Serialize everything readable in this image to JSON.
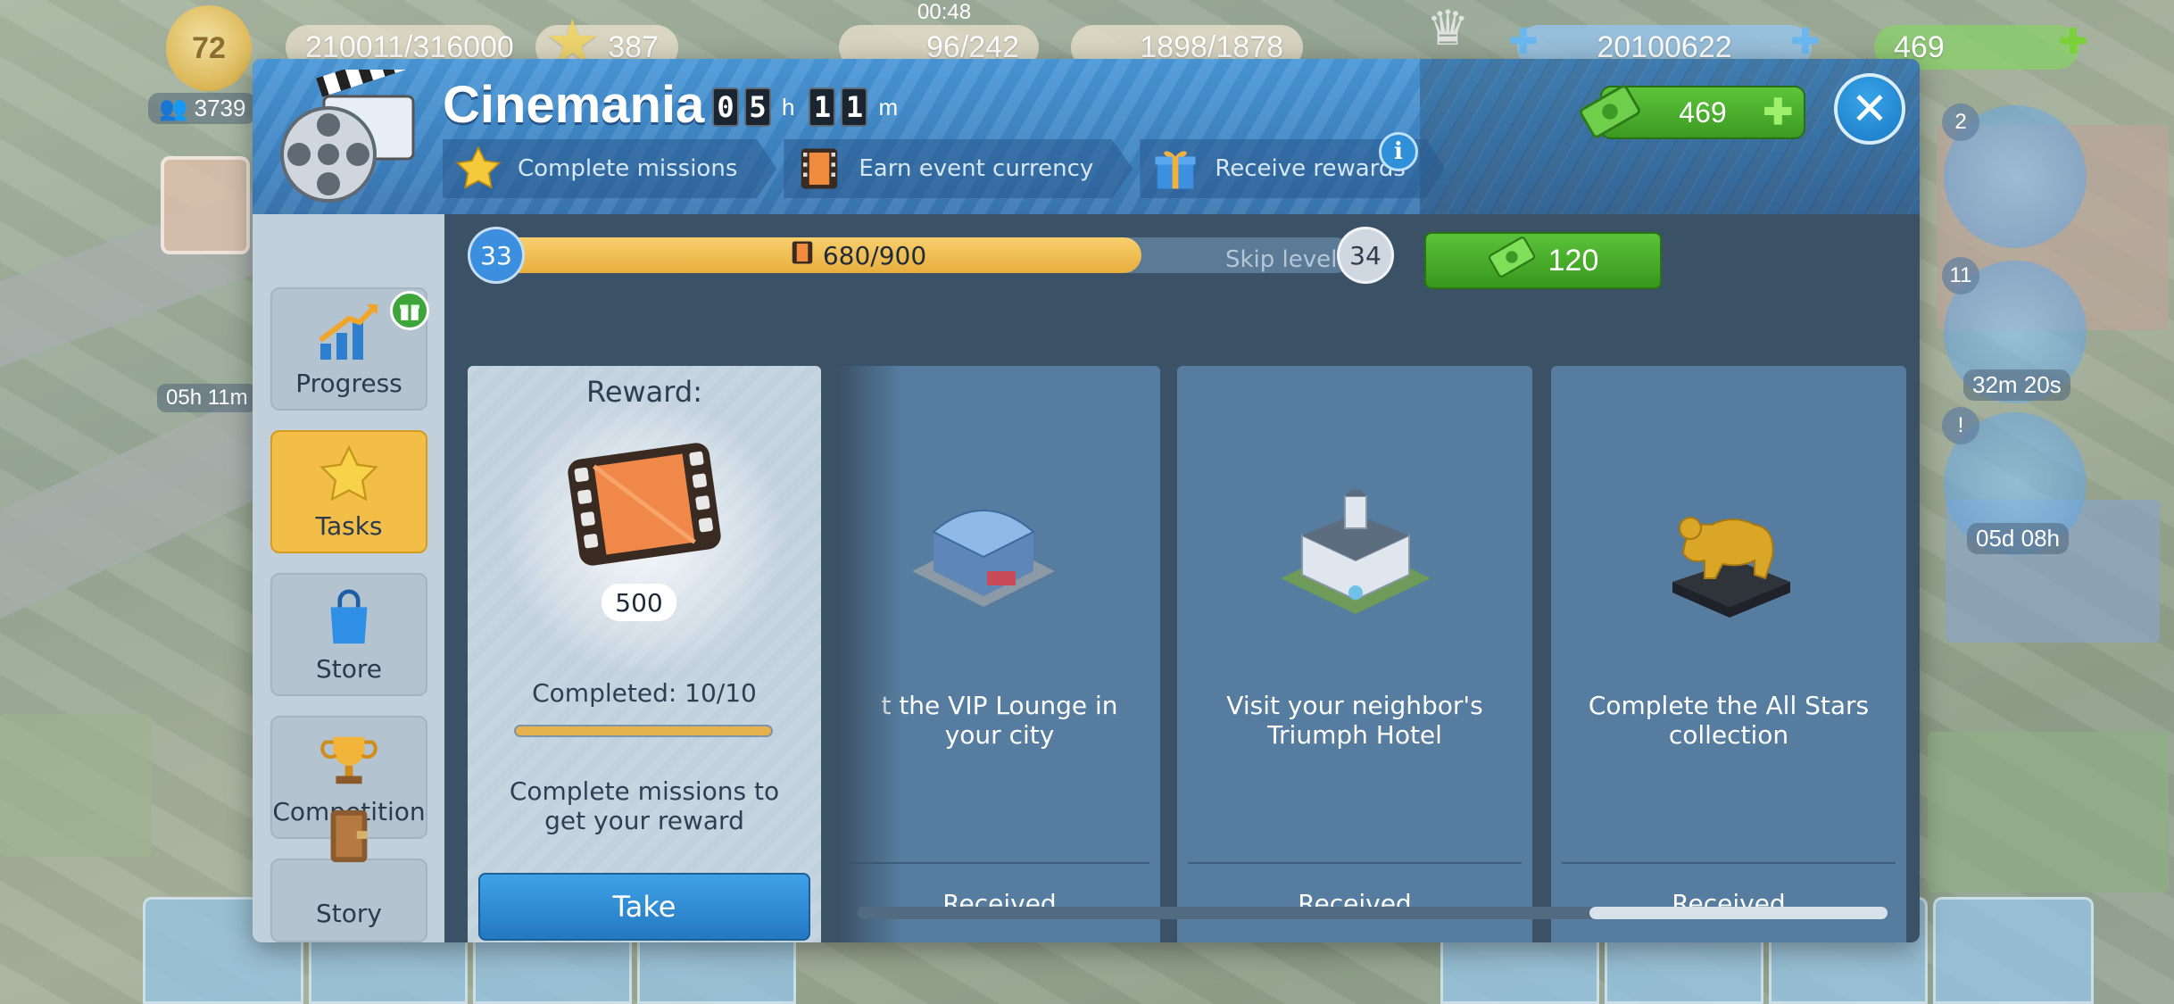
{
  "hud": {
    "level": "72",
    "xp": "210011/316000",
    "stars": "387",
    "timer": "00:48",
    "capacity": "96/242",
    "cargo": "1898/1878",
    "coins": "20100622",
    "cash": "469",
    "people": "3739"
  },
  "left_float": {
    "event_timer": "05h 11m"
  },
  "right_gauges": {
    "badge_1": "2",
    "badge_2": "11",
    "radar_timer": "32m 20s",
    "speed_timer": "05d 08h",
    "alert": "!"
  },
  "modal": {
    "title": "Cinemania",
    "timer_hours": [
      "0",
      "5"
    ],
    "timer_minutes": [
      "1",
      "1"
    ],
    "timer_h_unit": "h",
    "timer_m_unit": "m",
    "steps": [
      {
        "label": "Complete missions",
        "icon": "star-icon"
      },
      {
        "label": "Earn event currency",
        "icon": "film-frame-icon"
      },
      {
        "label": "Receive rewards",
        "icon": "gift-icon"
      }
    ],
    "info": "i",
    "cash": "469",
    "close": "✕"
  },
  "sidebar": {
    "items": [
      {
        "label": "Progress",
        "icon": "progress-chart-icon",
        "active": false
      },
      {
        "label": "Tasks",
        "icon": "star-icon",
        "active": true
      },
      {
        "label": "Store",
        "icon": "shopping-bag-icon",
        "active": false
      },
      {
        "label": "Competition",
        "icon": "trophy-icon",
        "active": false
      },
      {
        "label": "Story",
        "icon": "book-icon",
        "active": false
      }
    ]
  },
  "progress": {
    "current_level": "33",
    "next_level": "34",
    "value_text": "680/900",
    "fraction": 0.7556,
    "skip_label": "Skip level",
    "skip_cost": "120"
  },
  "reward": {
    "title": "Reward:",
    "amount": "500",
    "completed": "Completed: 10/10",
    "description": "Complete missions to get your reward",
    "take_label": "Take"
  },
  "missions": [
    {
      "text": "t the VIP Lounge in your city",
      "status": "Received",
      "icon": "vip-lounge-building-icon"
    },
    {
      "text": "Visit your neighbor's Triumph Hotel",
      "status": "Received",
      "icon": "triumph-hotel-icon"
    },
    {
      "text": "Complete the All Stars collection",
      "status": "Received",
      "icon": "golden-bear-statue-icon"
    }
  ],
  "colors": {
    "accent_blue": "#3f86c6",
    "active_tab": "#f2be48",
    "green_button": "#4cae2c",
    "card_blue": "#567d9f"
  }
}
